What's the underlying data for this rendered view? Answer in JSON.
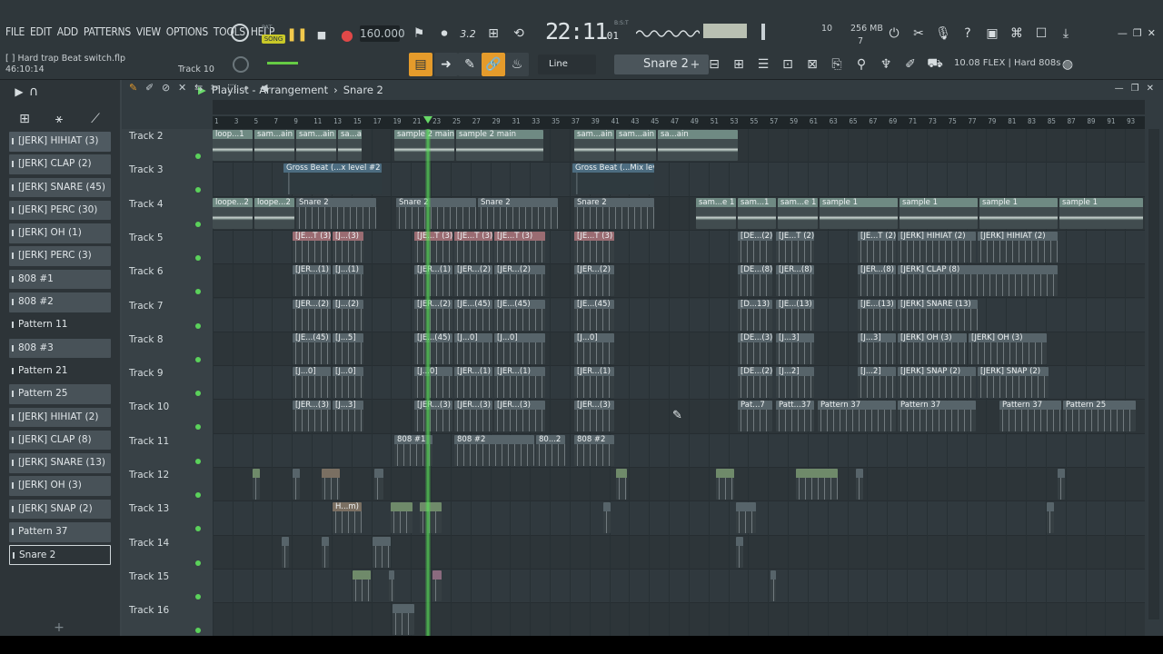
{
  "app": {
    "menu": [
      "FILE",
      "EDIT",
      "ADD",
      "PATTERNS",
      "VIEW",
      "OPTIONS",
      "TOOLS",
      "HELP"
    ],
    "hint_file": "[   ] Hard trap Beat switch.flp",
    "hint_time": "46:10:14",
    "hint_track": "Track 10",
    "song_mode": "SONG",
    "pat_label": "PAT",
    "tempo": "160.000",
    "clock_main": "22:11",
    "clock_sub": "01",
    "clock_bst": "B:S:T",
    "cpu_value": "10",
    "mem_value": "256 MB",
    "poly_value": "7",
    "step_value": "3.2",
    "tool_mode": "Line",
    "pattern_selected": "Snare 2",
    "flex_preset": "10.08  FLEX | Hard 808s"
  },
  "playlist": {
    "title": "Playlist - Arrangement",
    "separator": "›",
    "pattern": "Snare 2",
    "ruler_ticks": [
      "1",
      "3",
      "5",
      "7",
      "9",
      "11",
      "13",
      "15",
      "17",
      "19",
      "21",
      "23",
      "25",
      "27",
      "29",
      "31",
      "33",
      "35",
      "37",
      "39",
      "41",
      "43",
      "45",
      "47",
      "49",
      "51",
      "53",
      "55",
      "57",
      "59",
      "61",
      "63",
      "65",
      "67",
      "69",
      "71",
      "73",
      "75",
      "77",
      "79",
      "81",
      "83",
      "85",
      "87",
      "89",
      "91",
      "93"
    ],
    "tracks": [
      "Track 2",
      "Track 3",
      "Track 4",
      "Track 5",
      "Track 6",
      "Track 7",
      "Track 8",
      "Track 9",
      "Track 10",
      "Track 11",
      "Track 12",
      "Track 13",
      "Track 14",
      "Track 15",
      "Track 16"
    ]
  },
  "browser": {
    "channels": [
      {
        "label": "[JERK] HIHIAT (3)",
        "state": "sel"
      },
      {
        "label": "[JERK] CLAP (2)",
        "state": ""
      },
      {
        "label": "[JERK] SNARE (45)",
        "state": ""
      },
      {
        "label": "[JERK] PERC (30)",
        "state": ""
      },
      {
        "label": "[JERK] OH (1)",
        "state": ""
      },
      {
        "label": "[JERK] PERC (3)",
        "state": ""
      },
      {
        "label": "808 #1",
        "state": ""
      },
      {
        "label": "808 #2",
        "state": ""
      },
      {
        "label": "Pattern 11",
        "state": "plain"
      },
      {
        "label": "808 #3",
        "state": ""
      },
      {
        "label": "Pattern 21",
        "state": "plain"
      },
      {
        "label": "Pattern 25",
        "state": ""
      },
      {
        "label": "[JERK] HIHIAT (2)",
        "state": ""
      },
      {
        "label": "[JERK] CLAP (8)",
        "state": ""
      },
      {
        "label": "[JERK] SNARE (13)",
        "state": ""
      },
      {
        "label": "[JERK] OH (3)",
        "state": ""
      },
      {
        "label": "[JERK] SNAP (2)",
        "state": ""
      },
      {
        "label": "Pattern 37",
        "state": ""
      },
      {
        "label": "Snare 2",
        "state": "active"
      }
    ]
  },
  "clips": [
    {
      "track": 0,
      "label": "loop...1",
      "type": "audio",
      "start": 0,
      "len": 46
    },
    {
      "track": 0,
      "label": "sam...ain",
      "type": "audio",
      "start": 46,
      "len": 46
    },
    {
      "track": 0,
      "label": "sam...ain",
      "type": "audio",
      "start": 92,
      "len": 46
    },
    {
      "track": 0,
      "label": "sa...ain",
      "type": "audio",
      "start": 138,
      "len": 28
    },
    {
      "track": 0,
      "label": "sample 2 main",
      "type": "audio",
      "start": 200,
      "len": 68
    },
    {
      "track": 0,
      "label": "sample 2 main",
      "type": "audio",
      "start": 268,
      "len": 98
    },
    {
      "track": 0,
      "label": "sam...ain",
      "type": "audio",
      "start": 398,
      "len": 46
    },
    {
      "track": 0,
      "label": "sam...ain",
      "type": "audio",
      "start": 444,
      "len": 46
    },
    {
      "track": 0,
      "label": "sa...ain",
      "type": "audio",
      "start": 490,
      "len": 90
    },
    {
      "track": 1,
      "label": "Gross Beat (...x level #2",
      "type": "gross",
      "start": 78,
      "len": 110
    },
    {
      "track": 1,
      "label": "Gross Beat (...Mix level",
      "type": "gross",
      "start": 396,
      "len": 92
    },
    {
      "track": 2,
      "label": "loope...2",
      "type": "audio",
      "start": 0,
      "len": 46
    },
    {
      "track": 2,
      "label": "loope...2",
      "type": "audio",
      "start": 46,
      "len": 46
    },
    {
      "track": 2,
      "label": "Snare 2",
      "type": "pat",
      "start": 92,
      "len": 90
    },
    {
      "track": 2,
      "label": "Snare 2",
      "type": "pat",
      "start": 202,
      "len": 90
    },
    {
      "track": 2,
      "label": "Snare 2",
      "type": "pat",
      "start": 292,
      "len": 90
    },
    {
      "track": 2,
      "label": "Snare 2",
      "type": "pat",
      "start": 398,
      "len": 90
    },
    {
      "track": 2,
      "label": "sam...e 1",
      "type": "audio",
      "start": 532,
      "len": 46
    },
    {
      "track": 2,
      "label": "sam...1",
      "type": "audio",
      "start": 578,
      "len": 44
    },
    {
      "track": 2,
      "label": "sam...e 1",
      "type": "audio",
      "start": 622,
      "len": 46
    },
    {
      "track": 2,
      "label": "sample 1",
      "type": "audio",
      "start": 668,
      "len": 88
    },
    {
      "track": 2,
      "label": "sample 1",
      "type": "audio",
      "start": 756,
      "len": 88
    },
    {
      "track": 2,
      "label": "sample 1",
      "type": "audio",
      "start": 844,
      "len": 88
    },
    {
      "track": 2,
      "label": "sample 1",
      "type": "audio",
      "start": 932,
      "len": 94
    },
    {
      "track": 3,
      "label": "[JE...T (3)",
      "type": "red",
      "start": 88,
      "len": 44
    },
    {
      "track": 3,
      "label": "[J...(3)",
      "type": "red",
      "start": 132,
      "len": 36
    },
    {
      "track": 3,
      "label": "[JE...T (3)",
      "type": "red",
      "start": 222,
      "len": 44
    },
    {
      "track": 3,
      "label": "[JE...T (3)",
      "type": "red",
      "start": 266,
      "len": 44
    },
    {
      "track": 3,
      "label": "[JE...T (3)",
      "type": "red",
      "start": 310,
      "len": 58
    },
    {
      "track": 3,
      "label": "[JE...T (3)",
      "type": "red",
      "start": 398,
      "len": 46
    },
    {
      "track": 3,
      "label": "[DE...(2)",
      "type": "pat",
      "start": 578,
      "len": 40
    },
    {
      "track": 3,
      "label": "[JE...T (2)",
      "type": "pat",
      "start": 620,
      "len": 44
    },
    {
      "track": 3,
      "label": "[JE...T (2)",
      "type": "pat",
      "start": 710,
      "len": 44
    },
    {
      "track": 3,
      "label": "[JERK] HIHIAT (2)",
      "type": "pat",
      "start": 754,
      "len": 88
    },
    {
      "track": 3,
      "label": "[JERK] HIHIAT (2)",
      "type": "pat",
      "start": 842,
      "len": 90
    },
    {
      "track": 4,
      "label": "[JER...(1)",
      "type": "pat",
      "start": 88,
      "len": 44
    },
    {
      "track": 4,
      "label": "[J...(1)",
      "type": "pat",
      "start": 132,
      "len": 36
    },
    {
      "track": 4,
      "label": "[JER...(1)",
      "type": "pat",
      "start": 222,
      "len": 44
    },
    {
      "track": 4,
      "label": "[JER...(2)",
      "type": "pat",
      "start": 266,
      "len": 44
    },
    {
      "track": 4,
      "label": "[JER...(2)",
      "type": "pat",
      "start": 310,
      "len": 58
    },
    {
      "track": 4,
      "label": "[JER...(2)",
      "type": "pat",
      "start": 398,
      "len": 46
    },
    {
      "track": 4,
      "label": "[DE...(8)",
      "type": "pat",
      "start": 578,
      "len": 40
    },
    {
      "track": 4,
      "label": "[JER...(8)",
      "type": "pat",
      "start": 620,
      "len": 44
    },
    {
      "track": 4,
      "label": "[JER...(8)",
      "type": "pat",
      "start": 710,
      "len": 44
    },
    {
      "track": 4,
      "label": "[JERK] CLAP (8)",
      "type": "pat",
      "start": 754,
      "len": 178
    },
    {
      "track": 5,
      "label": "[JER...(2)",
      "type": "pat",
      "start": 88,
      "len": 44
    },
    {
      "track": 5,
      "label": "[J...(2)",
      "type": "pat",
      "start": 132,
      "len": 36
    },
    {
      "track": 5,
      "label": "[JER...(2)",
      "type": "pat",
      "start": 222,
      "len": 44
    },
    {
      "track": 5,
      "label": "[JE...(45)",
      "type": "pat",
      "start": 266,
      "len": 44
    },
    {
      "track": 5,
      "label": "[JE...(45)",
      "type": "pat",
      "start": 310,
      "len": 58
    },
    {
      "track": 5,
      "label": "[JE...(45)",
      "type": "pat",
      "start": 398,
      "len": 46
    },
    {
      "track": 5,
      "label": "[D...13)",
      "type": "pat",
      "start": 578,
      "len": 40
    },
    {
      "track": 5,
      "label": "[JE...(13)",
      "type": "pat",
      "start": 620,
      "len": 44
    },
    {
      "track": 5,
      "label": "[JE...(13)",
      "type": "pat",
      "start": 710,
      "len": 44
    },
    {
      "track": 5,
      "label": "[JERK] SNARE (13)",
      "type": "pat",
      "start": 754,
      "len": 90
    },
    {
      "track": 6,
      "label": "[JE...(45)",
      "type": "pat",
      "start": 88,
      "len": 44
    },
    {
      "track": 6,
      "label": "[J...5]",
      "type": "pat",
      "start": 132,
      "len": 36
    },
    {
      "track": 6,
      "label": "[JE...(45)",
      "type": "pat",
      "start": 222,
      "len": 44
    },
    {
      "track": 6,
      "label": "[J...0]",
      "type": "pat",
      "start": 266,
      "len": 44
    },
    {
      "track": 6,
      "label": "[J...0]",
      "type": "pat",
      "start": 310,
      "len": 58
    },
    {
      "track": 6,
      "label": "[J...0]",
      "type": "pat",
      "start": 398,
      "len": 46
    },
    {
      "track": 6,
      "label": "[DE...(3)",
      "type": "pat",
      "start": 578,
      "len": 40
    },
    {
      "track": 6,
      "label": "[J...3]",
      "type": "pat",
      "start": 620,
      "len": 44
    },
    {
      "track": 6,
      "label": "[J...3]",
      "type": "pat",
      "start": 710,
      "len": 44
    },
    {
      "track": 6,
      "label": "[JERK] OH (3)",
      "type": "pat",
      "start": 754,
      "len": 78
    },
    {
      "track": 6,
      "label": "[JERK] OH (3)",
      "type": "pat",
      "start": 832,
      "len": 88
    },
    {
      "track": 7,
      "label": "[J...0]",
      "type": "pat",
      "start": 88,
      "len": 44
    },
    {
      "track": 7,
      "label": "[J...0]",
      "type": "pat",
      "start": 132,
      "len": 36
    },
    {
      "track": 7,
      "label": "[J...0]",
      "type": "pat",
      "start": 222,
      "len": 44
    },
    {
      "track": 7,
      "label": "[JER...(1)",
      "type": "pat",
      "start": 266,
      "len": 44
    },
    {
      "track": 7,
      "label": "[JER...(1)",
      "type": "pat",
      "start": 310,
      "len": 58
    },
    {
      "track": 7,
      "label": "[JER...(1)",
      "type": "pat",
      "start": 398,
      "len": 46
    },
    {
      "track": 7,
      "label": "[DE...(2)",
      "type": "pat",
      "start": 578,
      "len": 40
    },
    {
      "track": 7,
      "label": "[J...2]",
      "type": "pat",
      "start": 620,
      "len": 44
    },
    {
      "track": 7,
      "label": "[J...2]",
      "type": "pat",
      "start": 710,
      "len": 44
    },
    {
      "track": 7,
      "label": "[JERK] SNAP (2)",
      "type": "pat",
      "start": 754,
      "len": 88
    },
    {
      "track": 7,
      "label": "[JERK] SNAP (2)",
      "type": "pat",
      "start": 842,
      "len": 80
    },
    {
      "track": 8,
      "label": "[JER...(3)",
      "type": "pat",
      "start": 88,
      "len": 44
    },
    {
      "track": 8,
      "label": "[J...3]",
      "type": "pat",
      "start": 132,
      "len": 36
    },
    {
      "track": 8,
      "label": "[JER...(3)",
      "type": "pat",
      "start": 222,
      "len": 44
    },
    {
      "track": 8,
      "label": "[JER...(3)",
      "type": "pat",
      "start": 266,
      "len": 44
    },
    {
      "track": 8,
      "label": "[JER...(3)",
      "type": "pat",
      "start": 310,
      "len": 58
    },
    {
      "track": 8,
      "label": "[JER...(3)",
      "type": "pat",
      "start": 398,
      "len": 46
    },
    {
      "track": 8,
      "label": "Pat...7",
      "type": "pat",
      "start": 578,
      "len": 40
    },
    {
      "track": 8,
      "label": "Patt...37",
      "type": "pat",
      "start": 620,
      "len": 44
    },
    {
      "track": 8,
      "label": "Pattern 37",
      "type": "pat",
      "start": 666,
      "len": 88
    },
    {
      "track": 8,
      "label": "Pattern 37",
      "type": "pat",
      "start": 754,
      "len": 88
    },
    {
      "track": 8,
      "label": "Pattern 37",
      "type": "pat",
      "start": 866,
      "len": 70
    },
    {
      "track": 8,
      "label": "Pattern 25",
      "type": "pat",
      "start": 936,
      "len": 82
    },
    {
      "track": 9,
      "label": "808 #1",
      "type": "pat",
      "start": 200,
      "len": 44
    },
    {
      "track": 9,
      "label": "808 #2",
      "type": "pat",
      "start": 266,
      "len": 90
    },
    {
      "track": 9,
      "label": "80...2",
      "type": "pat",
      "start": 356,
      "len": 34
    },
    {
      "track": 9,
      "label": "808 #2",
      "type": "pat",
      "start": 398,
      "len": 46
    },
    {
      "track": 10,
      "label": "",
      "type": "green",
      "start": 44,
      "len": 10
    },
    {
      "track": 10,
      "label": "",
      "type": "pat",
      "start": 88,
      "len": 10
    },
    {
      "track": 10,
      "label": "",
      "type": "brown",
      "start": 120,
      "len": 22
    },
    {
      "track": 10,
      "label": "",
      "type": "pat",
      "start": 178,
      "len": 12
    },
    {
      "track": 10,
      "label": "",
      "type": "green",
      "start": 444,
      "len": 14
    },
    {
      "track": 10,
      "label": "",
      "type": "green",
      "start": 554,
      "len": 22
    },
    {
      "track": 10,
      "label": "",
      "type": "green",
      "start": 642,
      "len": 48
    },
    {
      "track": 10,
      "label": "",
      "type": "pat",
      "start": 708,
      "len": 10
    },
    {
      "track": 10,
      "label": "",
      "type": "pat",
      "start": 930,
      "len": 10
    },
    {
      "track": 11,
      "label": "H...m)",
      "type": "brown",
      "start": 132,
      "len": 34
    },
    {
      "track": 11,
      "label": "",
      "type": "green",
      "start": 196,
      "len": 26
    },
    {
      "track": 11,
      "label": "",
      "type": "green",
      "start": 228,
      "len": 26
    },
    {
      "track": 11,
      "label": "",
      "type": "pat",
      "start": 430,
      "len": 10
    },
    {
      "track": 11,
      "label": "",
      "type": "pat",
      "start": 576,
      "len": 24
    },
    {
      "track": 11,
      "label": "",
      "type": "pat",
      "start": 918,
      "len": 10
    },
    {
      "track": 12,
      "label": "",
      "type": "pat",
      "start": 76,
      "len": 10
    },
    {
      "track": 12,
      "label": "",
      "type": "pat",
      "start": 120,
      "len": 10
    },
    {
      "track": 12,
      "label": "",
      "type": "pat",
      "start": 176,
      "len": 22
    },
    {
      "track": 12,
      "label": "",
      "type": "pat",
      "start": 576,
      "len": 10
    },
    {
      "track": 13,
      "label": "",
      "type": "green",
      "start": 154,
      "len": 22
    },
    {
      "track": 13,
      "label": "",
      "type": "pat",
      "start": 194,
      "len": 6
    },
    {
      "track": 13,
      "label": "",
      "type": "mauve",
      "start": 242,
      "len": 12
    },
    {
      "track": 13,
      "label": "",
      "type": "pat",
      "start": 614,
      "len": 6
    },
    {
      "track": 14,
      "label": "",
      "type": "pat",
      "start": 198,
      "len": 26
    }
  ],
  "cursor": "✎"
}
